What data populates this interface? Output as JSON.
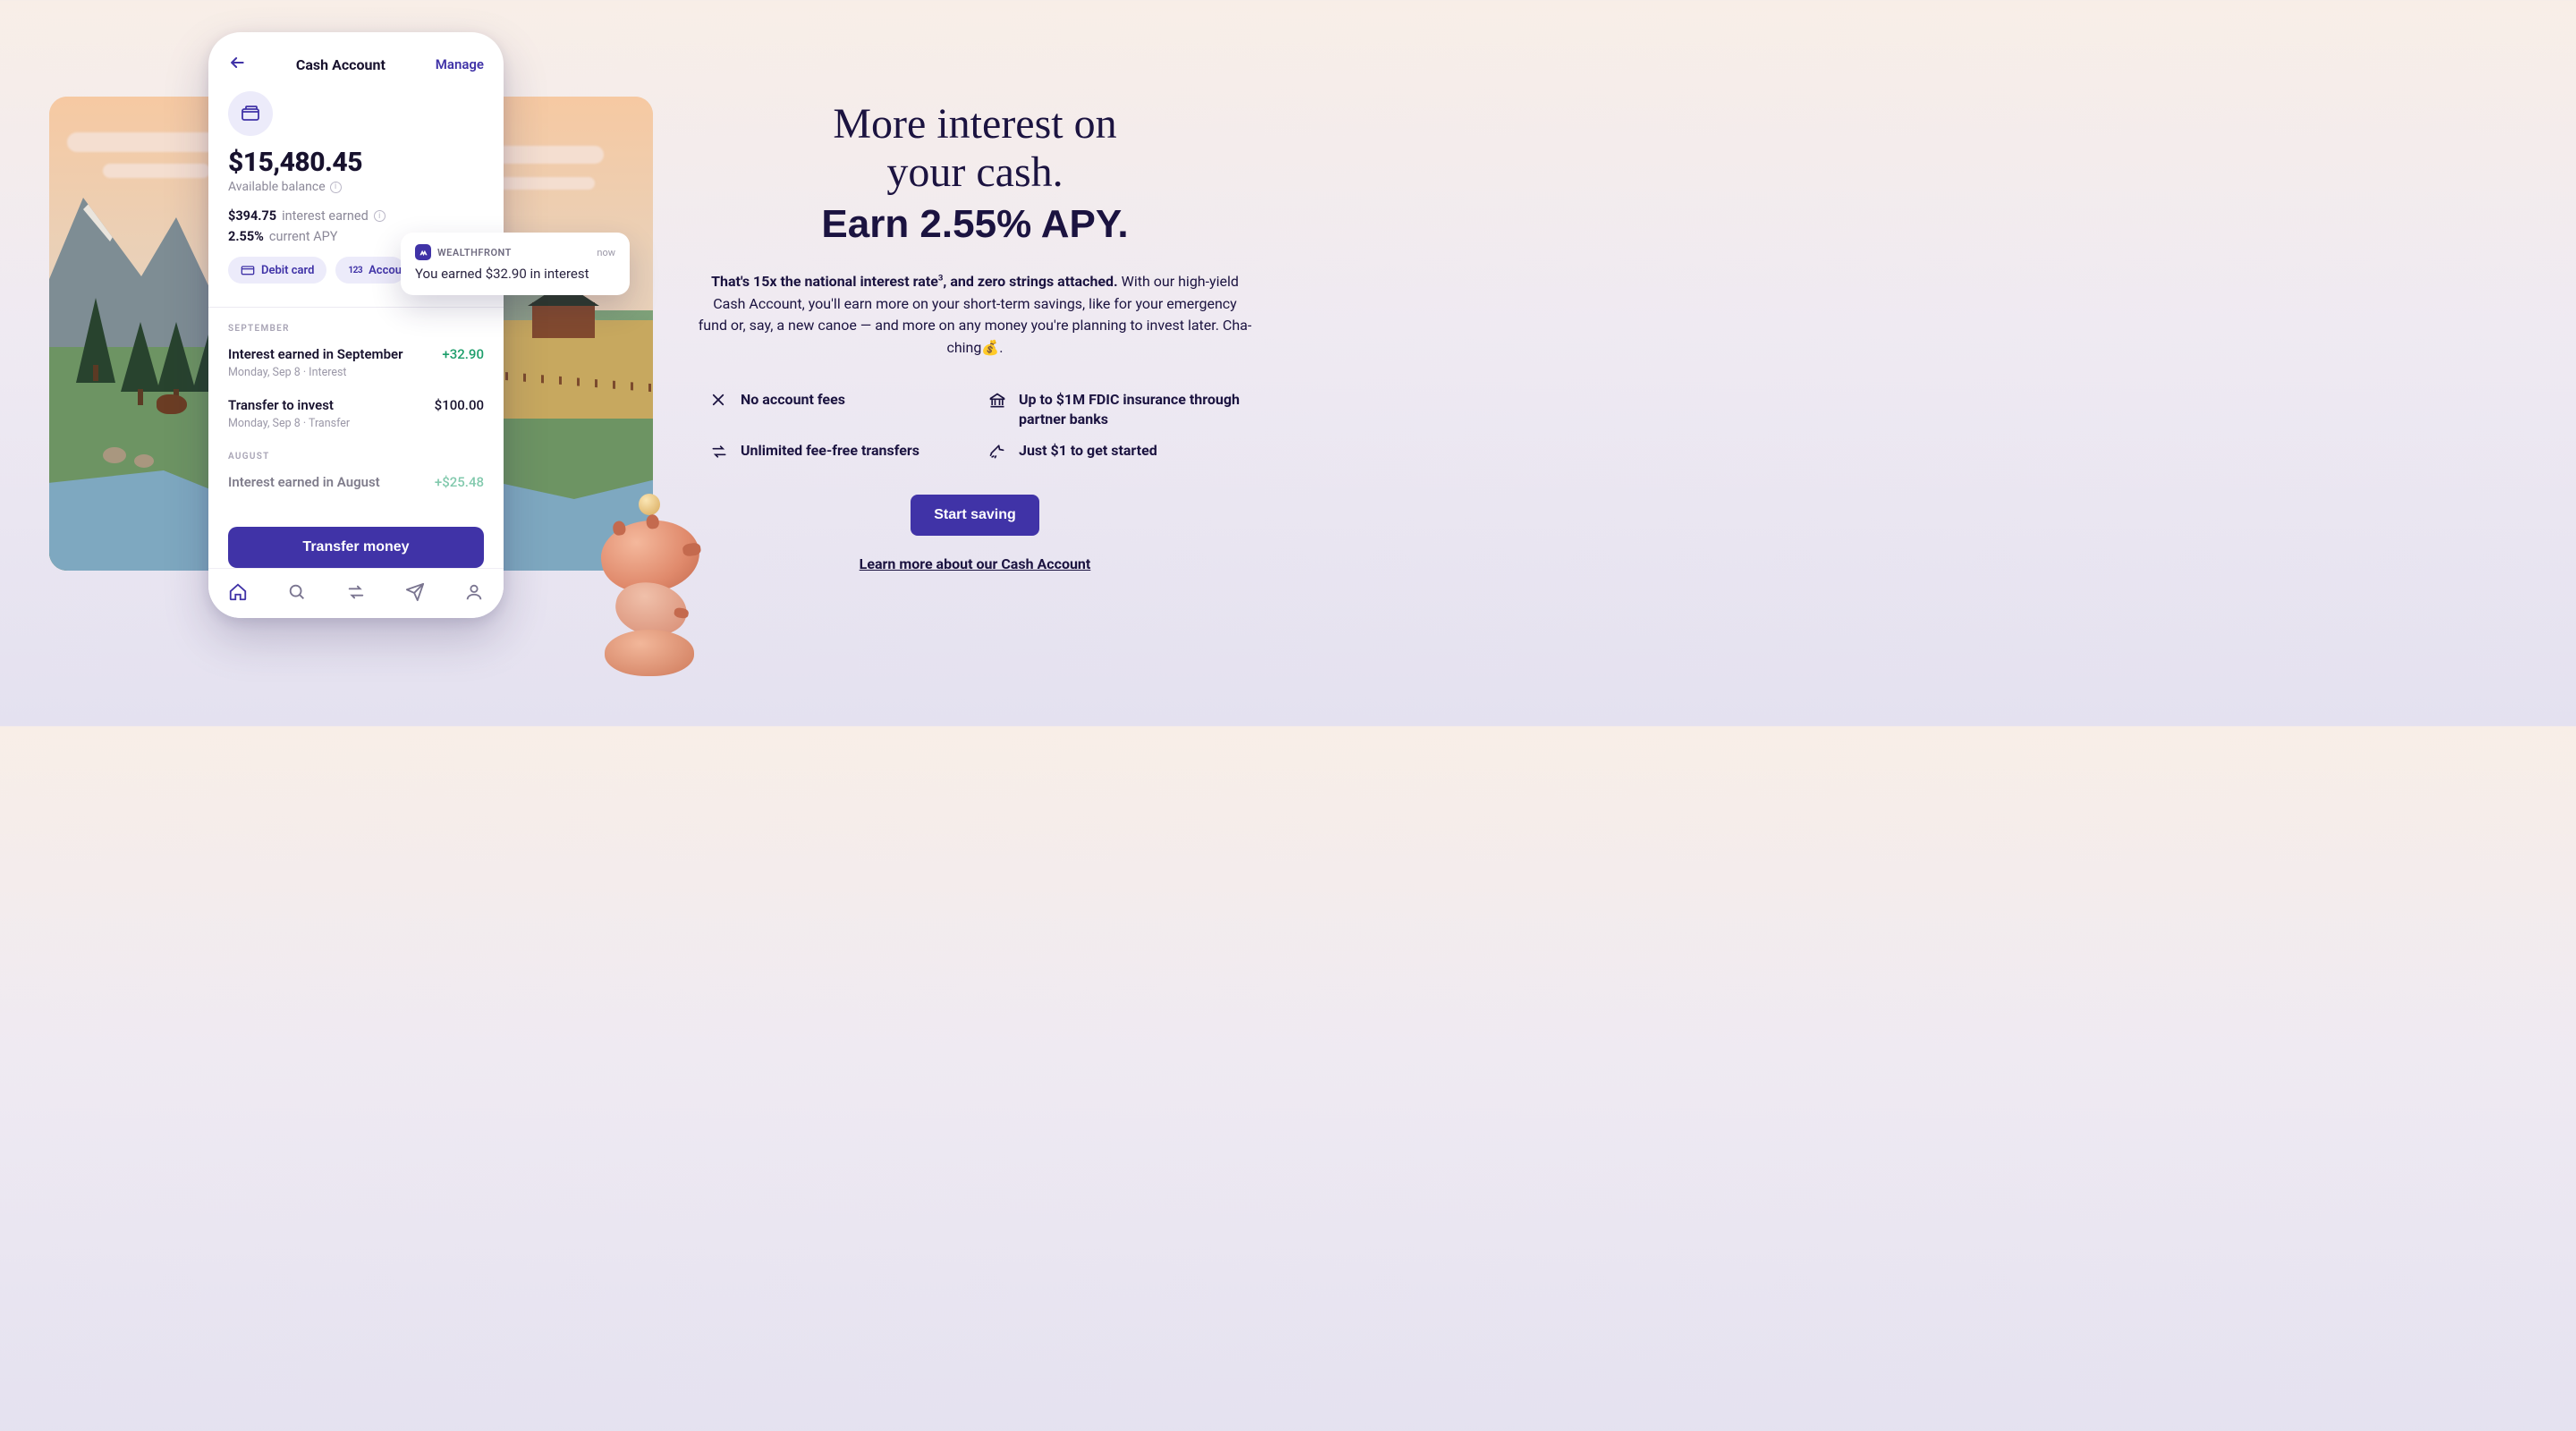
{
  "phone": {
    "title": "Cash Account",
    "manage": "Manage",
    "balance": "$15,480.45",
    "balance_label": "Available balance",
    "interest_earned": "$394.75",
    "interest_earned_label": "interest earned",
    "apy": "2.55%",
    "apy_label": "current APY",
    "chips": {
      "debit": "Debit card",
      "account": "Account"
    },
    "months": {
      "sep": {
        "label": "SEPTEMBER",
        "txns": [
          {
            "name": "Interest earned in September",
            "sub": "Monday, Sep 8 · Interest",
            "amt": "+32.90",
            "pos": true
          },
          {
            "name": "Transfer to invest",
            "sub": "Monday, Sep 8 · Transfer",
            "amt": "$100.00",
            "pos": false
          }
        ]
      },
      "aug": {
        "label": "AUGUST",
        "txn_name": "Interest earned in August",
        "txn_amt": "+$25.48"
      }
    },
    "cta": "Transfer money"
  },
  "notif": {
    "app": "WEALTHFRONT",
    "time": "now",
    "body": "You earned $32.90 in interest"
  },
  "copy": {
    "h1_line1": "More interest on",
    "h1_line2": "your cash.",
    "h1_bold": "Earn 2.55% APY.",
    "lead_strong": "That's 15x the national interest rate",
    "lead_sup": "3",
    "lead_strong_tail": ", and zero strings attached.",
    "lead_rest": " With our high-yield Cash Account, you'll earn more on your short-term savings, like for your emergency fund or, say, a new canoe — and more on any money you're planning to invest later. Cha-ching💰.",
    "features": {
      "f1": "No account fees",
      "f2": "Up to $1M FDIC insurance through partner banks",
      "f3": "Unlimited fee-free transfers",
      "f4": "Just $1 to get started"
    },
    "cta": "Start saving",
    "learn": "Learn more about our Cash Account"
  }
}
